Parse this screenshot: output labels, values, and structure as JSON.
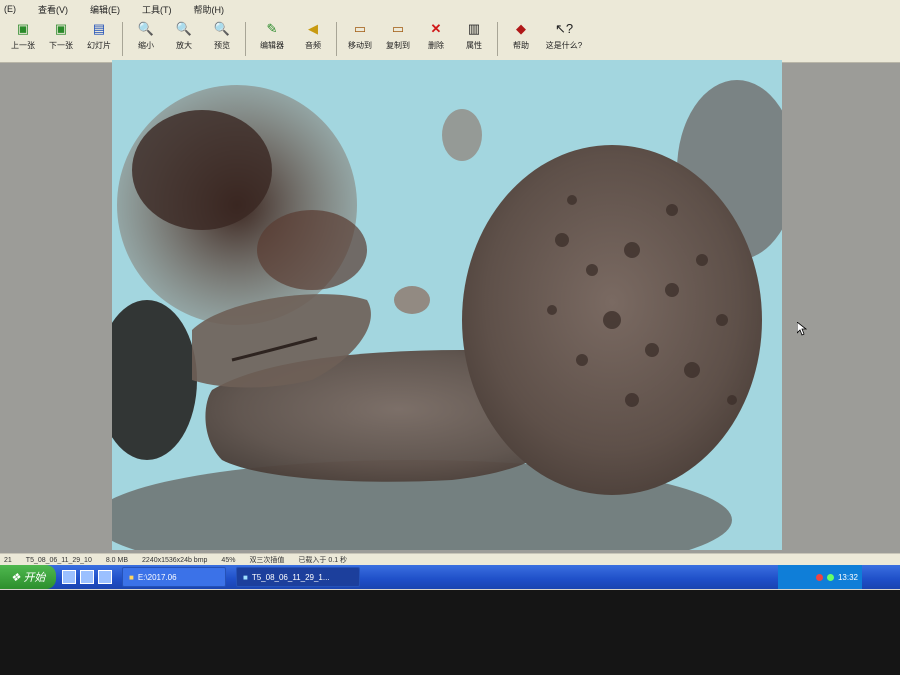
{
  "menu": {
    "items": [
      "(E)",
      "查看(V)",
      "编辑(E)",
      "工具(T)",
      "帮助(H)"
    ]
  },
  "toolbar": {
    "buttons": [
      {
        "label": "上一张",
        "icon": "prev-image-icon"
      },
      {
        "label": "下一张",
        "icon": "next-image-icon"
      },
      {
        "label": "幻灯片",
        "icon": "slideshow-icon"
      },
      {
        "label": "缩小",
        "icon": "zoom-out-icon"
      },
      {
        "label": "放大",
        "icon": "zoom-in-icon"
      },
      {
        "label": "预览",
        "icon": "preview-icon"
      },
      {
        "label": "编辑器",
        "icon": "editor-icon"
      },
      {
        "label": "音频",
        "icon": "audio-icon"
      },
      {
        "label": "移动到",
        "icon": "move-to-icon"
      },
      {
        "label": "复制到",
        "icon": "copy-to-icon"
      },
      {
        "label": "删除",
        "icon": "delete-icon"
      },
      {
        "label": "属性",
        "icon": "properties-icon"
      },
      {
        "label": "帮助",
        "icon": "help-icon"
      },
      {
        "label": "这是什么?",
        "icon": "whats-this-icon"
      }
    ]
  },
  "statusbar": {
    "index": "21",
    "filename": "T5_08_06_11_29_10",
    "size": "8.0 MB",
    "dimensions": "2240x1536x24b bmp",
    "zoom": "45%",
    "mode": "双三次插值",
    "loaded": "已载入于 0.1 秒"
  },
  "taskbar": {
    "start_label": "开始",
    "tasks": [
      {
        "label": "E:\\2017.06"
      },
      {
        "label": "T5_08_06_11_29_1..."
      }
    ],
    "clock": "13:32"
  },
  "colors": {
    "taskbar": "#1f4fc8",
    "start_button": "#2d8f2d",
    "viewer_background": "#9c9c98",
    "micrograph_background": "#9fd3dc"
  }
}
